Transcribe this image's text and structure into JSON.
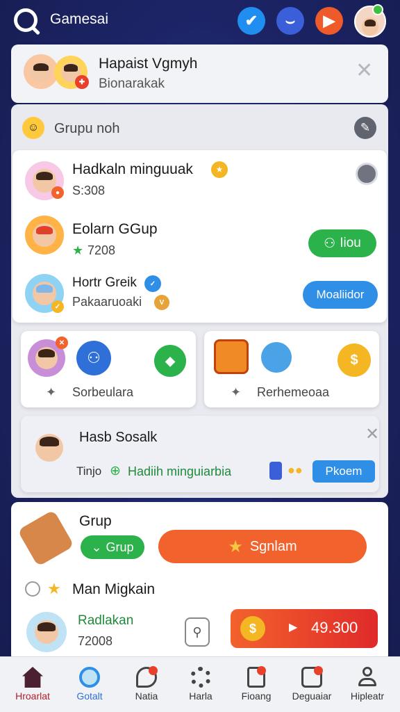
{
  "topbar": {
    "title": "Gamesai",
    "buttons": [
      {
        "icon": "check-shield-icon",
        "color": "#1f8ef0"
      },
      {
        "icon": "pocket-icon",
        "color": "#3a5fd8"
      },
      {
        "icon": "play-icon",
        "color": "#ef5a2a"
      }
    ]
  },
  "notification": {
    "title": "Hapaist Vgmyh",
    "subtitle": "Bionarakak"
  },
  "group_section": {
    "header": "Grupu noh",
    "items": [
      {
        "name": "Hadkaln minguuak",
        "meta": "S:308",
        "action": "",
        "action_type": "icon"
      },
      {
        "name": "Eolarn GGup",
        "meta": "7208",
        "action": "Iiou",
        "action_type": "green"
      },
      {
        "name": "Hortr Greik",
        "meta": "Pakaaruoaki",
        "action": "Moaliidor",
        "action_type": "blue"
      }
    ]
  },
  "tiles": [
    {
      "label": "Sorbeulara"
    },
    {
      "label": "Rerhemeoaa"
    }
  ],
  "social": {
    "title": "Hasb Sosalk",
    "prefix": "Tinjo",
    "link": "Hadiih minguiarbia",
    "button": "Pkoem"
  },
  "group_card": {
    "title": "Grup",
    "chip": "Grup",
    "cta": "Sgnlam",
    "subheading": "Man Migkain",
    "player_name": "Radlakan",
    "player_score": "72008",
    "reward": "49.300"
  },
  "nav": [
    {
      "label": "Hroarlat",
      "icon": "home-icon",
      "active": true
    },
    {
      "label": "Gotalt",
      "icon": "globe-icon",
      "active": false
    },
    {
      "label": "Natia",
      "icon": "chat-icon",
      "active": false
    },
    {
      "label": "Harla",
      "icon": "gear-icon",
      "active": false
    },
    {
      "label": "Fioang",
      "icon": "document-icon",
      "active": false
    },
    {
      "label": "Deguaiar",
      "icon": "message-icon",
      "active": false
    },
    {
      "label": "Hipleatr",
      "icon": "profile-icon",
      "active": false
    }
  ],
  "colors": {
    "green": "#2bb24a",
    "blue": "#2f8fe6",
    "orange": "#f2622c",
    "red": "#e8402a"
  }
}
